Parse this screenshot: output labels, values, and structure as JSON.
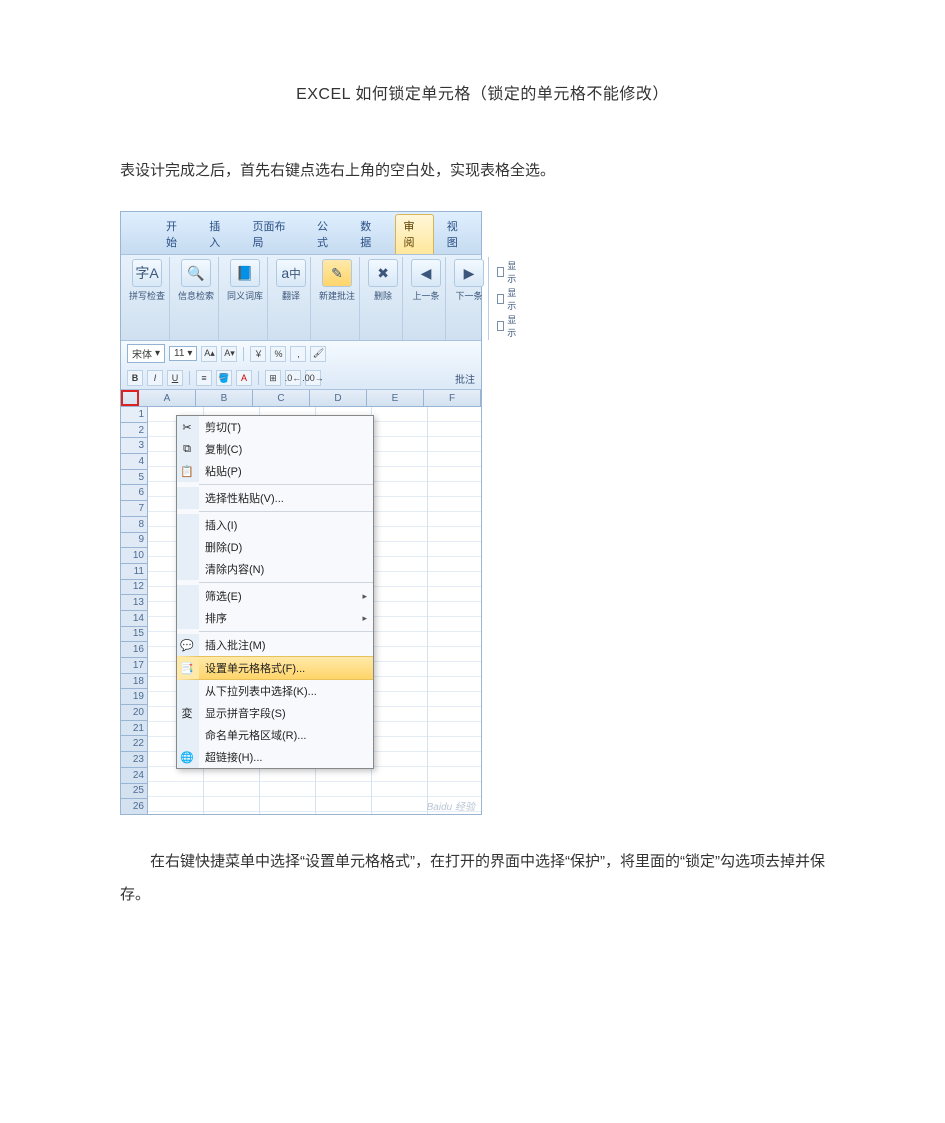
{
  "title": "EXCEL 如何锁定单元格（锁定的单元格不能修改）",
  "para1": "表设计完成之后，首先右键点选右上角的空白处，实现表格全选。",
  "para2": "在右键快捷菜单中选择“设置单元格格式”，在打开的界面中选择“保护”，将里面的“锁定”勾选项去掉并保存。",
  "excel": {
    "ribbon_tabs": [
      "开始",
      "插入",
      "页面布局",
      "公式",
      "数据",
      "审阅",
      "视图"
    ],
    "active_tab_index": 5,
    "groups": {
      "g1": "拼写检查",
      "g2": "信息检索",
      "g3": "同义词库",
      "g4": "翻译",
      "g5": "新建批注",
      "g6": "删除",
      "g7": "上一条",
      "g8": "下一条",
      "g9a": "显示",
      "g9b": "显示",
      "g9c": "显示",
      "right_label": "批注"
    },
    "format_bar": {
      "font": "宋体",
      "size": "11",
      "bold": "B",
      "italic": "I",
      "underline": "U"
    },
    "columns": [
      "A",
      "B",
      "C",
      "D",
      "E",
      "F"
    ],
    "rows": [
      1,
      2,
      3,
      4,
      5,
      6,
      7,
      8,
      9,
      10,
      11,
      12,
      13,
      14,
      15,
      16,
      17,
      18,
      19,
      20,
      21,
      22,
      23,
      24,
      25,
      26
    ],
    "context_menu": {
      "cut": "剪切(T)",
      "copy": "复制(C)",
      "paste": "粘贴(P)",
      "paste_special": "选择性粘贴(V)...",
      "insert": "插入(I)",
      "delete": "删除(D)",
      "clear": "清除内容(N)",
      "filter": "筛选(E)",
      "sort": "排序",
      "insert_comment": "插入批注(M)",
      "format_cells": "设置单元格格式(F)...",
      "dropdown": "从下拉列表中选择(K)...",
      "phonetic": "显示拼音字段(S)",
      "name_range": "命名单元格区域(R)...",
      "hyperlink": "超链接(H)..."
    },
    "watermark": "Baidu 经验"
  }
}
